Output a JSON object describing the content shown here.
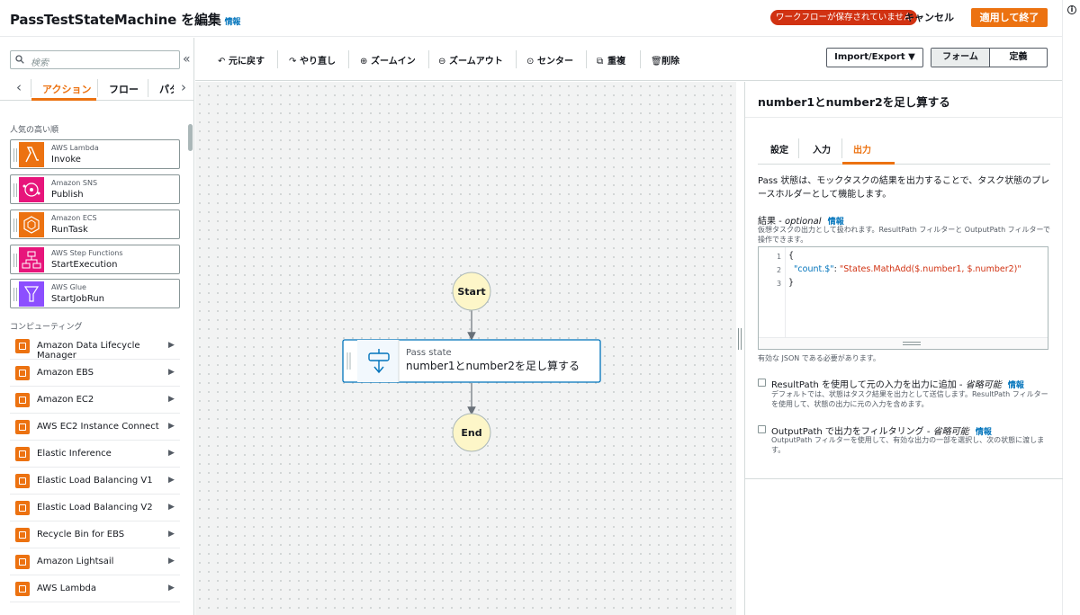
{
  "header": {
    "title": "PassTestStateMachine を編集",
    "info": "情報",
    "unsaved_badge": "ワークフローが保存されていません",
    "cancel": "キャンセル",
    "apply": "適用して終了"
  },
  "left_panel": {
    "search_placeholder": "検索",
    "tabs": [
      "アクション",
      "フロー",
      "パタ"
    ],
    "popular_heading": "人気の高い順",
    "popular": [
      {
        "service": "AWS Lambda",
        "action": "Invoke",
        "color": "#ec7211"
      },
      {
        "service": "Amazon SNS",
        "action": "Publish",
        "color": "#e7157b"
      },
      {
        "service": "Amazon ECS",
        "action": "RunTask",
        "color": "#ec7211"
      },
      {
        "service": "AWS Step Functions",
        "action": "StartExecution",
        "color": "#e7157b"
      },
      {
        "service": "AWS Glue",
        "action": "StartJobRun",
        "color": "#8c4fff"
      }
    ],
    "compute_heading": "コンピューティング",
    "compute": [
      "Amazon Data Lifecycle Manager",
      "Amazon EBS",
      "Amazon EC2",
      "AWS EC2 Instance Connect",
      "Elastic Inference",
      "Elastic Load Balancing V1",
      "Elastic Load Balancing V2",
      "Recycle Bin for EBS",
      "Amazon Lightsail",
      "AWS Lambda"
    ]
  },
  "toolbar": {
    "undo": "元に戻す",
    "redo": "やり直し",
    "zoom_in": "ズームイン",
    "zoom_out": "ズームアウト",
    "center": "センター",
    "duplicate": "重複",
    "delete": "削除",
    "import_export": "Import/Export",
    "mode_form": "フォーム",
    "mode_definition": "定義"
  },
  "graph": {
    "start": "Start",
    "state_type": "Pass state",
    "state_name": "number1とnumber2を足し算する",
    "end": "End"
  },
  "inspector": {
    "title": "number1とnumber2を足し算する",
    "tabs": [
      "設定",
      "入力",
      "出力"
    ],
    "active_tab": "出力",
    "description": "Pass 状態は、モックタスクの結果を出力することで、タスク状態のプレースホルダーとして機能します。",
    "result_label": "結果 - ",
    "result_optional": "optional",
    "result_info": "情報",
    "result_sub": "仮想タスクの出力として扱われます。ResultPath フィルターと OutputPath フィルターで操作できます。",
    "code_line1": "{",
    "code_key": "\"count.$\"",
    "code_colon": ": ",
    "code_value": "\"States.MathAdd($.number1, $.number2)\"",
    "code_line3": "}",
    "json_note": "有効な JSON である必要があります。",
    "resultpath_label": "ResultPath を使用して元の入力を出力に追加 - ",
    "resultpath_optional": "省略可能",
    "resultpath_info": "情報",
    "resultpath_sub": "デフォルトでは、状態はタスク結果を出力として送信します。ResultPath フィルターを使用して、状態の出力に元の入力を含めます。",
    "outputpath_label": "OutputPath で出力をフィルタリング - ",
    "outputpath_optional": "省略可能",
    "outputpath_info": "情報",
    "outputpath_sub": "OutputPath フィルターを使用して、有効な出力の一部を選択し、次の状態に渡します。"
  }
}
